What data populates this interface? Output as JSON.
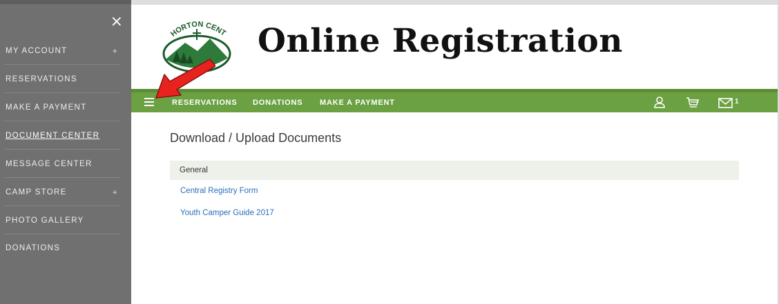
{
  "sidebar": {
    "close_label": "×",
    "items": [
      {
        "label": "MY ACCOUNT",
        "expander": "+"
      },
      {
        "label": "RESERVATIONS",
        "expander": ""
      },
      {
        "label": "MAKE A PAYMENT",
        "expander": ""
      },
      {
        "label": "DOCUMENT CENTER",
        "expander": "",
        "active": true
      },
      {
        "label": "MESSAGE CENTER",
        "expander": ""
      },
      {
        "label": "CAMP STORE",
        "expander": "+"
      },
      {
        "label": "PHOTO GALLERY",
        "expander": ""
      },
      {
        "label": "DONATIONS",
        "expander": ""
      }
    ]
  },
  "header": {
    "logo_text": "HORTON CENTER",
    "title": "Online Registration"
  },
  "navbar": {
    "links": [
      "RESERVATIONS",
      "DONATIONS",
      "MAKE A PAYMENT"
    ],
    "message_count": "1",
    "color": "#6ba142"
  },
  "content": {
    "heading": "Download / Upload Documents",
    "section_title": "General",
    "documents": [
      "Central Registry Form",
      "Youth Camper Guide 2017"
    ]
  },
  "colors": {
    "sidebar_bg": "#707070",
    "link": "#2a6ebb",
    "arrow": "#e8231f"
  }
}
